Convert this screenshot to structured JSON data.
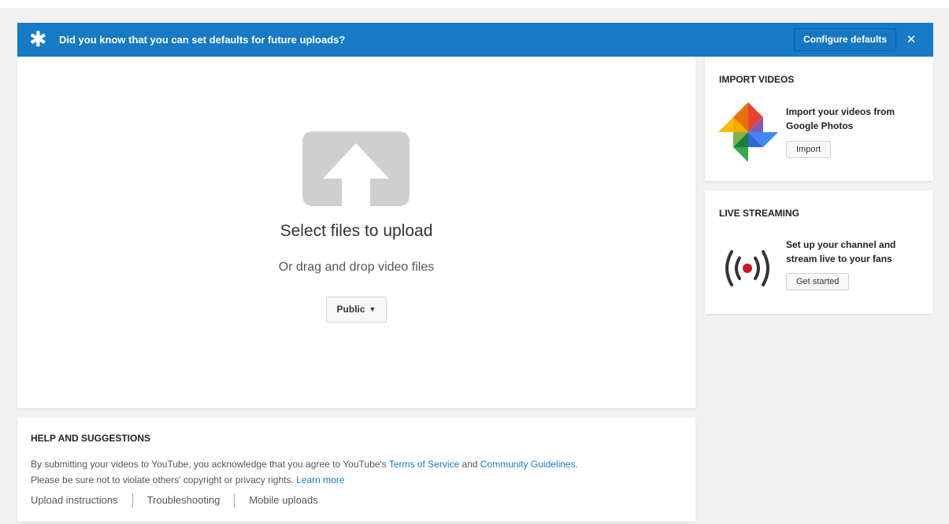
{
  "banner": {
    "icon": "asterisk-icon",
    "message": "Did you know that you can set defaults for future uploads?",
    "configure_label": "Configure defaults",
    "close_label": "✕",
    "color": "#167ac6"
  },
  "upload": {
    "icon": "upload-arrow-icon",
    "title": "Select files to upload",
    "subtitle": "Or drag and drop video files",
    "privacy_value": "Public"
  },
  "help": {
    "title": "HELP AND SUGGESTIONS",
    "line1_prefix": "By submitting your videos to YouTube, you acknowledge that you agree to YouTube's ",
    "terms_link": "Terms of Service",
    "and_text": " and ",
    "guidelines_link": "Community Guidelines",
    "line1_suffix": ".",
    "line2_prefix": "Please be sure not to violate others' copyright or privacy rights. ",
    "learn_more_link": "Learn more",
    "links": [
      "Upload instructions",
      "Troubleshooting",
      "Mobile uploads"
    ],
    "link_color": "#167ac6"
  },
  "import_videos": {
    "title": "IMPORT VIDEOS",
    "icon": "google-photos-icon",
    "description": "Import your videos from Google Photos",
    "button_label": "Import"
  },
  "live_streaming": {
    "title": "LIVE STREAMING",
    "icon": "live-broadcast-icon",
    "description": "Set up your channel and stream live to your fans",
    "button_label": "Get started"
  }
}
